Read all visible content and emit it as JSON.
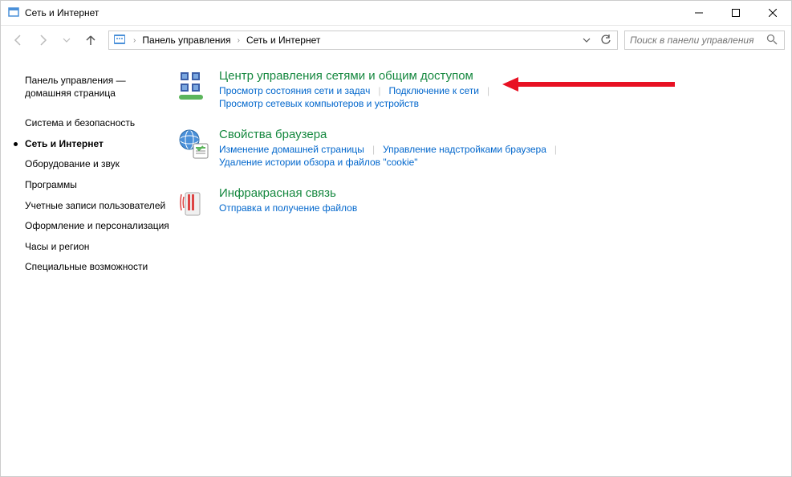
{
  "window": {
    "title": "Сеть и Интернет"
  },
  "breadcrumb": {
    "items": [
      "Панель управления",
      "Сеть и Интернет"
    ]
  },
  "search": {
    "placeholder": "Поиск в панели управления"
  },
  "sidebar": {
    "home": "Панель управления — домашняя страница",
    "items": [
      "Система и безопасность",
      "Сеть и Интернет",
      "Оборудование и звук",
      "Программы",
      "Учетные записи пользователей",
      "Оформление и персонализация",
      "Часы и регион",
      "Специальные возможности"
    ],
    "active_index": 1
  },
  "categories": [
    {
      "title": "Центр управления сетями и общим доступом",
      "links": [
        [
          "Просмотр состояния сети и задач",
          "Подключение к сети"
        ],
        [
          "Просмотр сетевых компьютеров и устройств"
        ]
      ]
    },
    {
      "title": "Свойства браузера",
      "links": [
        [
          "Изменение домашней страницы",
          "Управление надстройками браузера"
        ],
        [
          "Удаление истории обзора и файлов \"cookie\""
        ]
      ]
    },
    {
      "title": "Инфракрасная связь",
      "links": [
        [
          "Отправка и получение файлов"
        ]
      ]
    }
  ]
}
